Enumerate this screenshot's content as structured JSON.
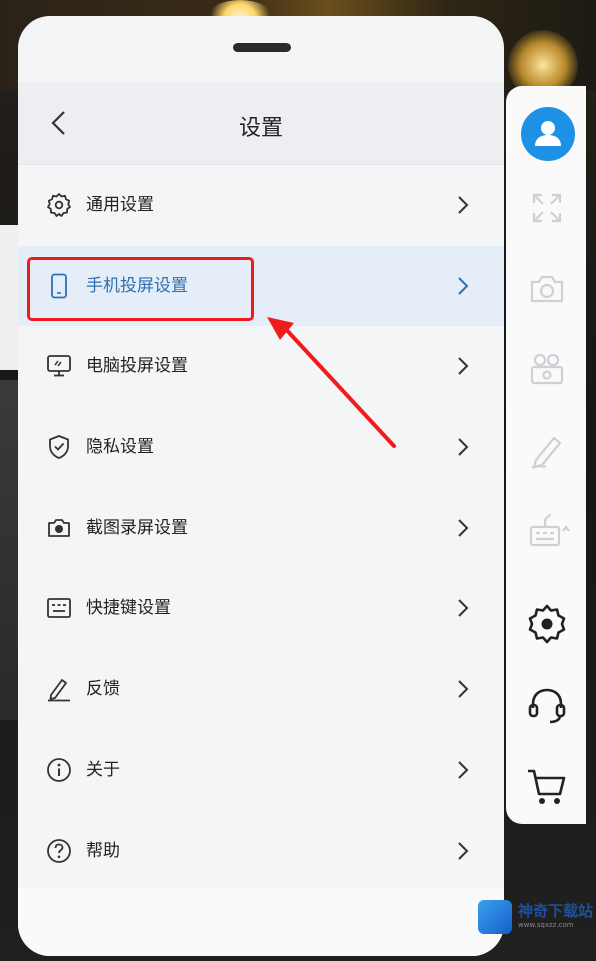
{
  "header": {
    "title": "设置"
  },
  "menu": {
    "items": [
      {
        "label": "通用设置",
        "icon": "gear-icon"
      },
      {
        "label": "手机投屏设置",
        "icon": "phone-icon",
        "selected": true
      },
      {
        "label": "电脑投屏设置",
        "icon": "monitor-icon"
      },
      {
        "label": "隐私设置",
        "icon": "shield-icon"
      },
      {
        "label": "截图录屏设置",
        "icon": "camera-icon"
      },
      {
        "label": "快捷键设置",
        "icon": "keyboard-icon"
      },
      {
        "label": "反馈",
        "icon": "pencil-icon"
      },
      {
        "label": "关于",
        "icon": "info-icon"
      },
      {
        "label": "帮助",
        "icon": "help-icon"
      }
    ]
  },
  "sidebar": {
    "buttons": [
      "avatar-icon",
      "fullscreen-icon",
      "screenshot-icon",
      "record-icon",
      "pen-icon",
      "keyboard-icon",
      "settings-icon",
      "support-icon",
      "cart-icon"
    ]
  },
  "watermark": {
    "name": "神奇下载站",
    "url": "www.sqxzz.com"
  },
  "colors": {
    "accent": "#2f6fb5",
    "highlight": "#ee1c1c",
    "avatar": "#1e90e6"
  }
}
